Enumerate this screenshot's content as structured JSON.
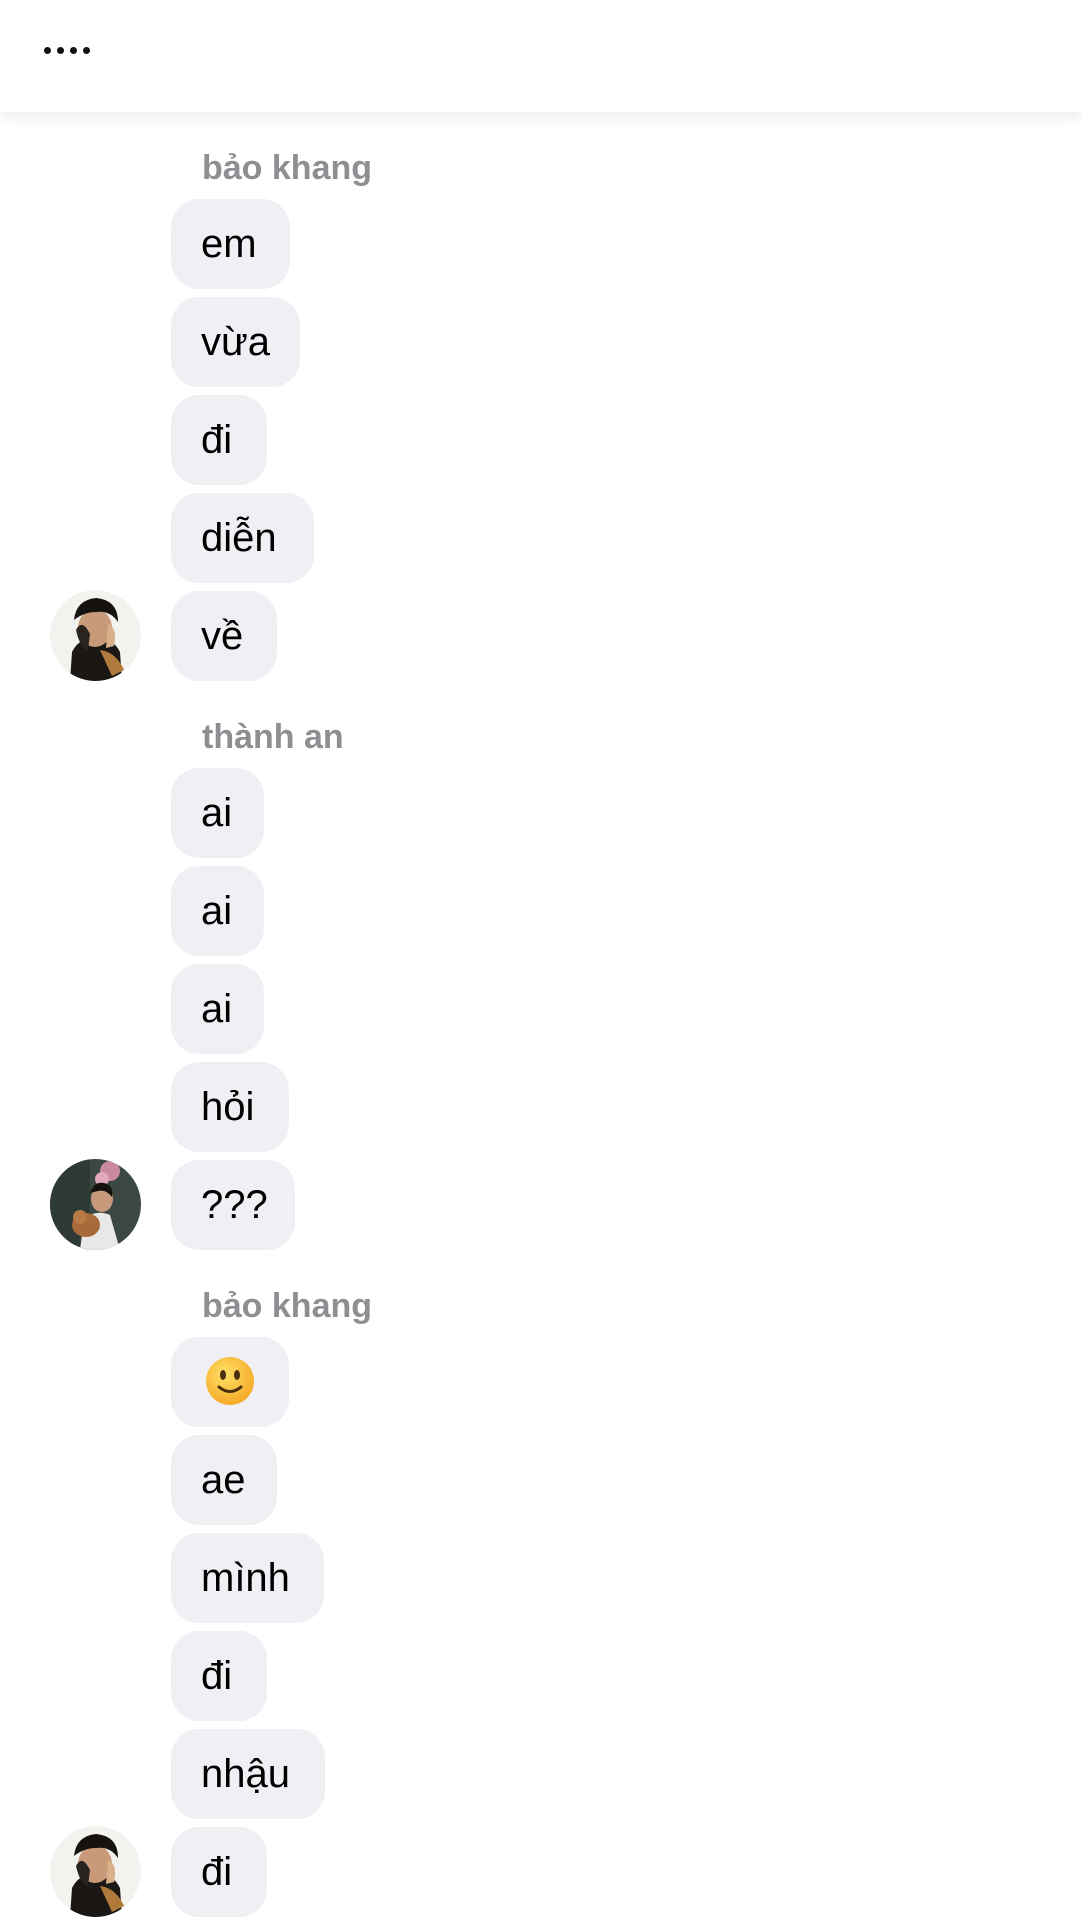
{
  "header": {
    "more_icon": "more-dots-icon"
  },
  "messages": {
    "group1": {
      "sender": "bảo khang",
      "bubbles": [
        "em",
        "vừa",
        "đi",
        "diễn",
        "về"
      ]
    },
    "group2": {
      "sender": "thành an",
      "bubbles": [
        "ai",
        "ai",
        "ai",
        "hỏi",
        "???"
      ]
    },
    "group3": {
      "sender": "bảo khang",
      "emoji": "slightly-smiling-face-icon",
      "bubbles": [
        "ae",
        "mình",
        "đi",
        "nhậu",
        "đi"
      ]
    }
  }
}
